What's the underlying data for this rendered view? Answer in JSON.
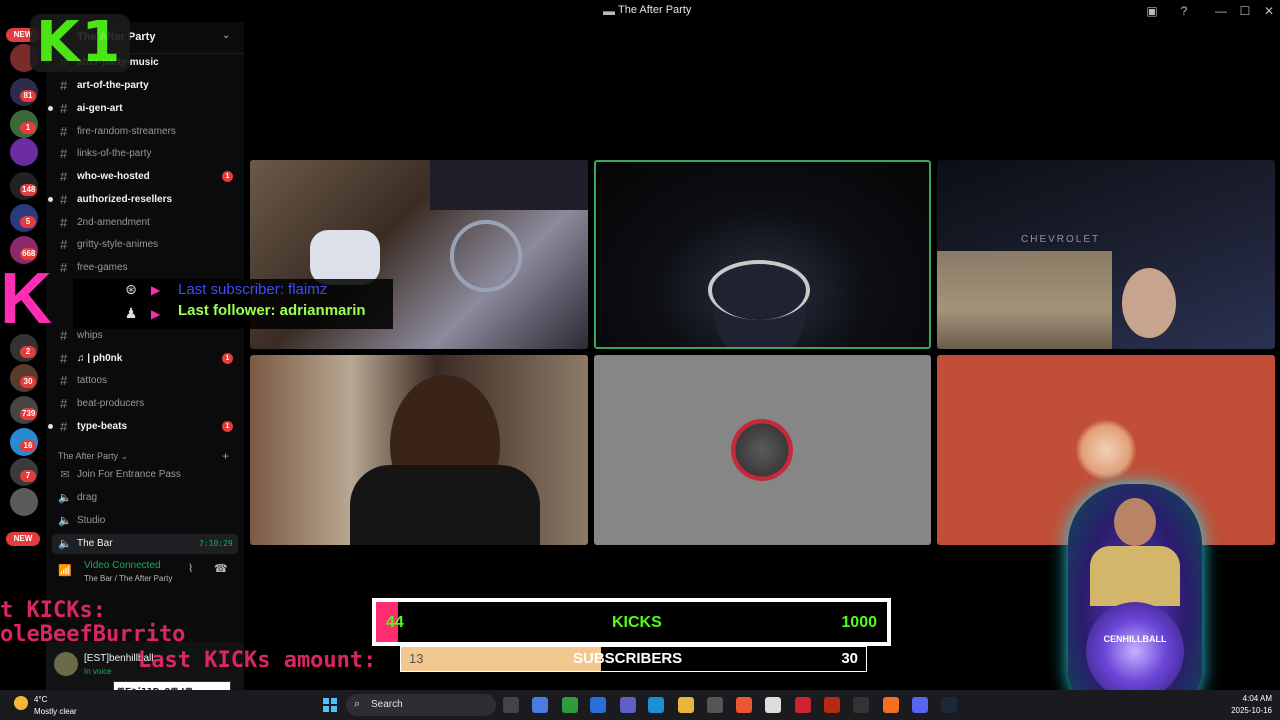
{
  "window": {
    "title": "The After Party"
  },
  "server": {
    "name": "The After Party"
  },
  "channels": [
    {
      "label": "after-party-music",
      "bold": true
    },
    {
      "label": "art-of-the-party",
      "bold": true
    },
    {
      "label": "ai-gen-art",
      "bold": true
    },
    {
      "label": "fire-random-streamers",
      "bold": false
    },
    {
      "label": "links-of-the-party",
      "bold": false
    },
    {
      "label": "who-we-hosted",
      "bold": true,
      "unread": "1"
    },
    {
      "label": "authorized-resellers",
      "bold": true
    },
    {
      "label": "2nd-amendment",
      "bold": false
    },
    {
      "label": "gritty-style-animes",
      "bold": false
    },
    {
      "label": "free-games",
      "bold": false
    },
    {
      "label": "whips",
      "bold": false
    },
    {
      "label": "♫ | ph0nk",
      "bold": true,
      "unread": "1"
    },
    {
      "label": "tattoos",
      "bold": false
    },
    {
      "label": "beat-producers",
      "bold": false
    },
    {
      "label": "type-beats",
      "bold": true,
      "unread": "1"
    }
  ],
  "category": {
    "label": "The After Party"
  },
  "voice_channels": [
    {
      "label": "Join For Entrance Pass"
    },
    {
      "label": "drag"
    },
    {
      "label": "Studio"
    },
    {
      "label": "The Bar",
      "timer": "7:10:29",
      "active": true
    }
  ],
  "voice_status": {
    "state": "Video Connected",
    "location": "The Bar / The After Party"
  },
  "user": {
    "name": "[EST]benhillball",
    "status": "In voice"
  },
  "rail": {
    "new_top": "NEW",
    "new_bottom": "NEW",
    "badges": [
      "81",
      "1",
      "148",
      "5",
      "668",
      "2",
      "30",
      "739",
      "16",
      "7"
    ]
  },
  "overlay": {
    "last_subscriber": "Last subscriber: flaimz",
    "last_follower": "Last follower: adrianmarin",
    "kicks_line1": "t KICKs:",
    "kicks_line2": "oleBeefBurrito",
    "kicks_line3": "Last KICKs amount:",
    "k_logo": "K1",
    "video_brand": "CHEVROLET",
    "orb_text": "CENHILLBALL"
  },
  "goals": {
    "kicks": {
      "current": "44",
      "label": "KICKS",
      "target": "1000",
      "fraction": 0.044
    },
    "subs": {
      "current": "13",
      "label": "SUBSCRIBERS",
      "target": "30",
      "fraction": 0.43
    }
  },
  "counter": {
    "text": "ꙮ∑∂illBa8ꙮɖꙮ"
  },
  "taskbar": {
    "temp": "4°C",
    "condition": "Mostly clear",
    "search": "Search",
    "time": "4:04 AM",
    "date": "2025-10-16"
  },
  "colors": {
    "kick_green": "#53fc18",
    "accent_pink": "#ff2d6f",
    "voice_green": "#23a55a",
    "unread_red": "#e23c3c"
  }
}
